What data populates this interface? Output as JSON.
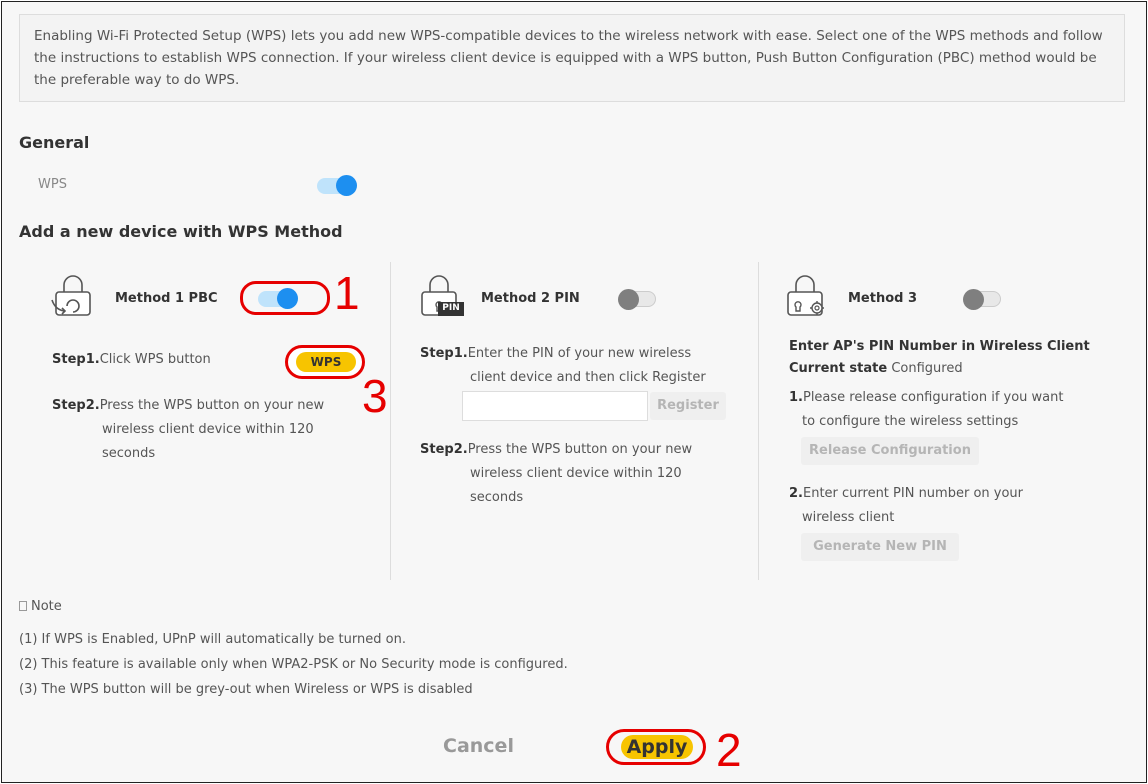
{
  "intro_text": "Enabling Wi-Fi Protected Setup (WPS) lets you add new WPS-compatible devices to the wireless network with ease. Select one of the WPS methods and follow the instructions to establish WPS connection. If your wireless client device is equipped with a WPS button, Push Button Configuration (PBC) method would be the preferable way to do WPS.",
  "general": {
    "heading": "General",
    "wps_label": "WPS",
    "wps_enabled": true
  },
  "add_device_heading": "Add a new device with WPS Method",
  "method1": {
    "title": "Method 1 PBC",
    "enabled": true,
    "step1_label": "Step1.",
    "step1_text": "Click WPS button",
    "wps_button": "WPS",
    "step2_label": "Step2.",
    "step2_line1": "Press the WPS button on your new",
    "step2_line2": "wireless client device within 120",
    "step2_line3": "seconds"
  },
  "method2": {
    "title": "Method 2 PIN",
    "enabled": false,
    "pin_badge": "PIN",
    "step1_label": "Step1.",
    "step1_line1": "Enter the PIN of your new wireless",
    "step1_line2": "client device and then click Register",
    "pin_value": "",
    "register_button": "Register",
    "step2_label": "Step2.",
    "step2_line1": "Press the WPS button on your new",
    "step2_line2": "wireless client device within 120",
    "step2_line3": "seconds"
  },
  "method3": {
    "title": "Method 3",
    "enabled": false,
    "heading_line1": "Enter AP's PIN Number in Wireless Client",
    "state_label": "Current state",
    "state_value": "Configured",
    "item1_num": "1.",
    "item1_line1": "Please release configuration if you want",
    "item1_line2": "to configure the wireless settings",
    "release_button": "Release Configuration",
    "item2_num": "2.",
    "item2_line1": "Enter current PIN number on your",
    "item2_line2": "wireless client",
    "generate_button": "Generate New PIN"
  },
  "note": {
    "title": "Note",
    "lines": [
      "(1) If WPS is Enabled, UPnP will automatically be turned on.",
      "(2) This feature is available only when WPA2-PSK or No Security mode is configured.",
      "(3) The WPS button will be grey-out when Wireless or WPS is disabled"
    ]
  },
  "buttons": {
    "cancel": "Cancel",
    "apply": "Apply"
  },
  "callouts": {
    "one": "1",
    "two": "2",
    "three": "3"
  },
  "colors": {
    "accent_blue": "#1d8ff0",
    "highlight_yellow": "#f7c400",
    "callout_red": "#e60000"
  }
}
